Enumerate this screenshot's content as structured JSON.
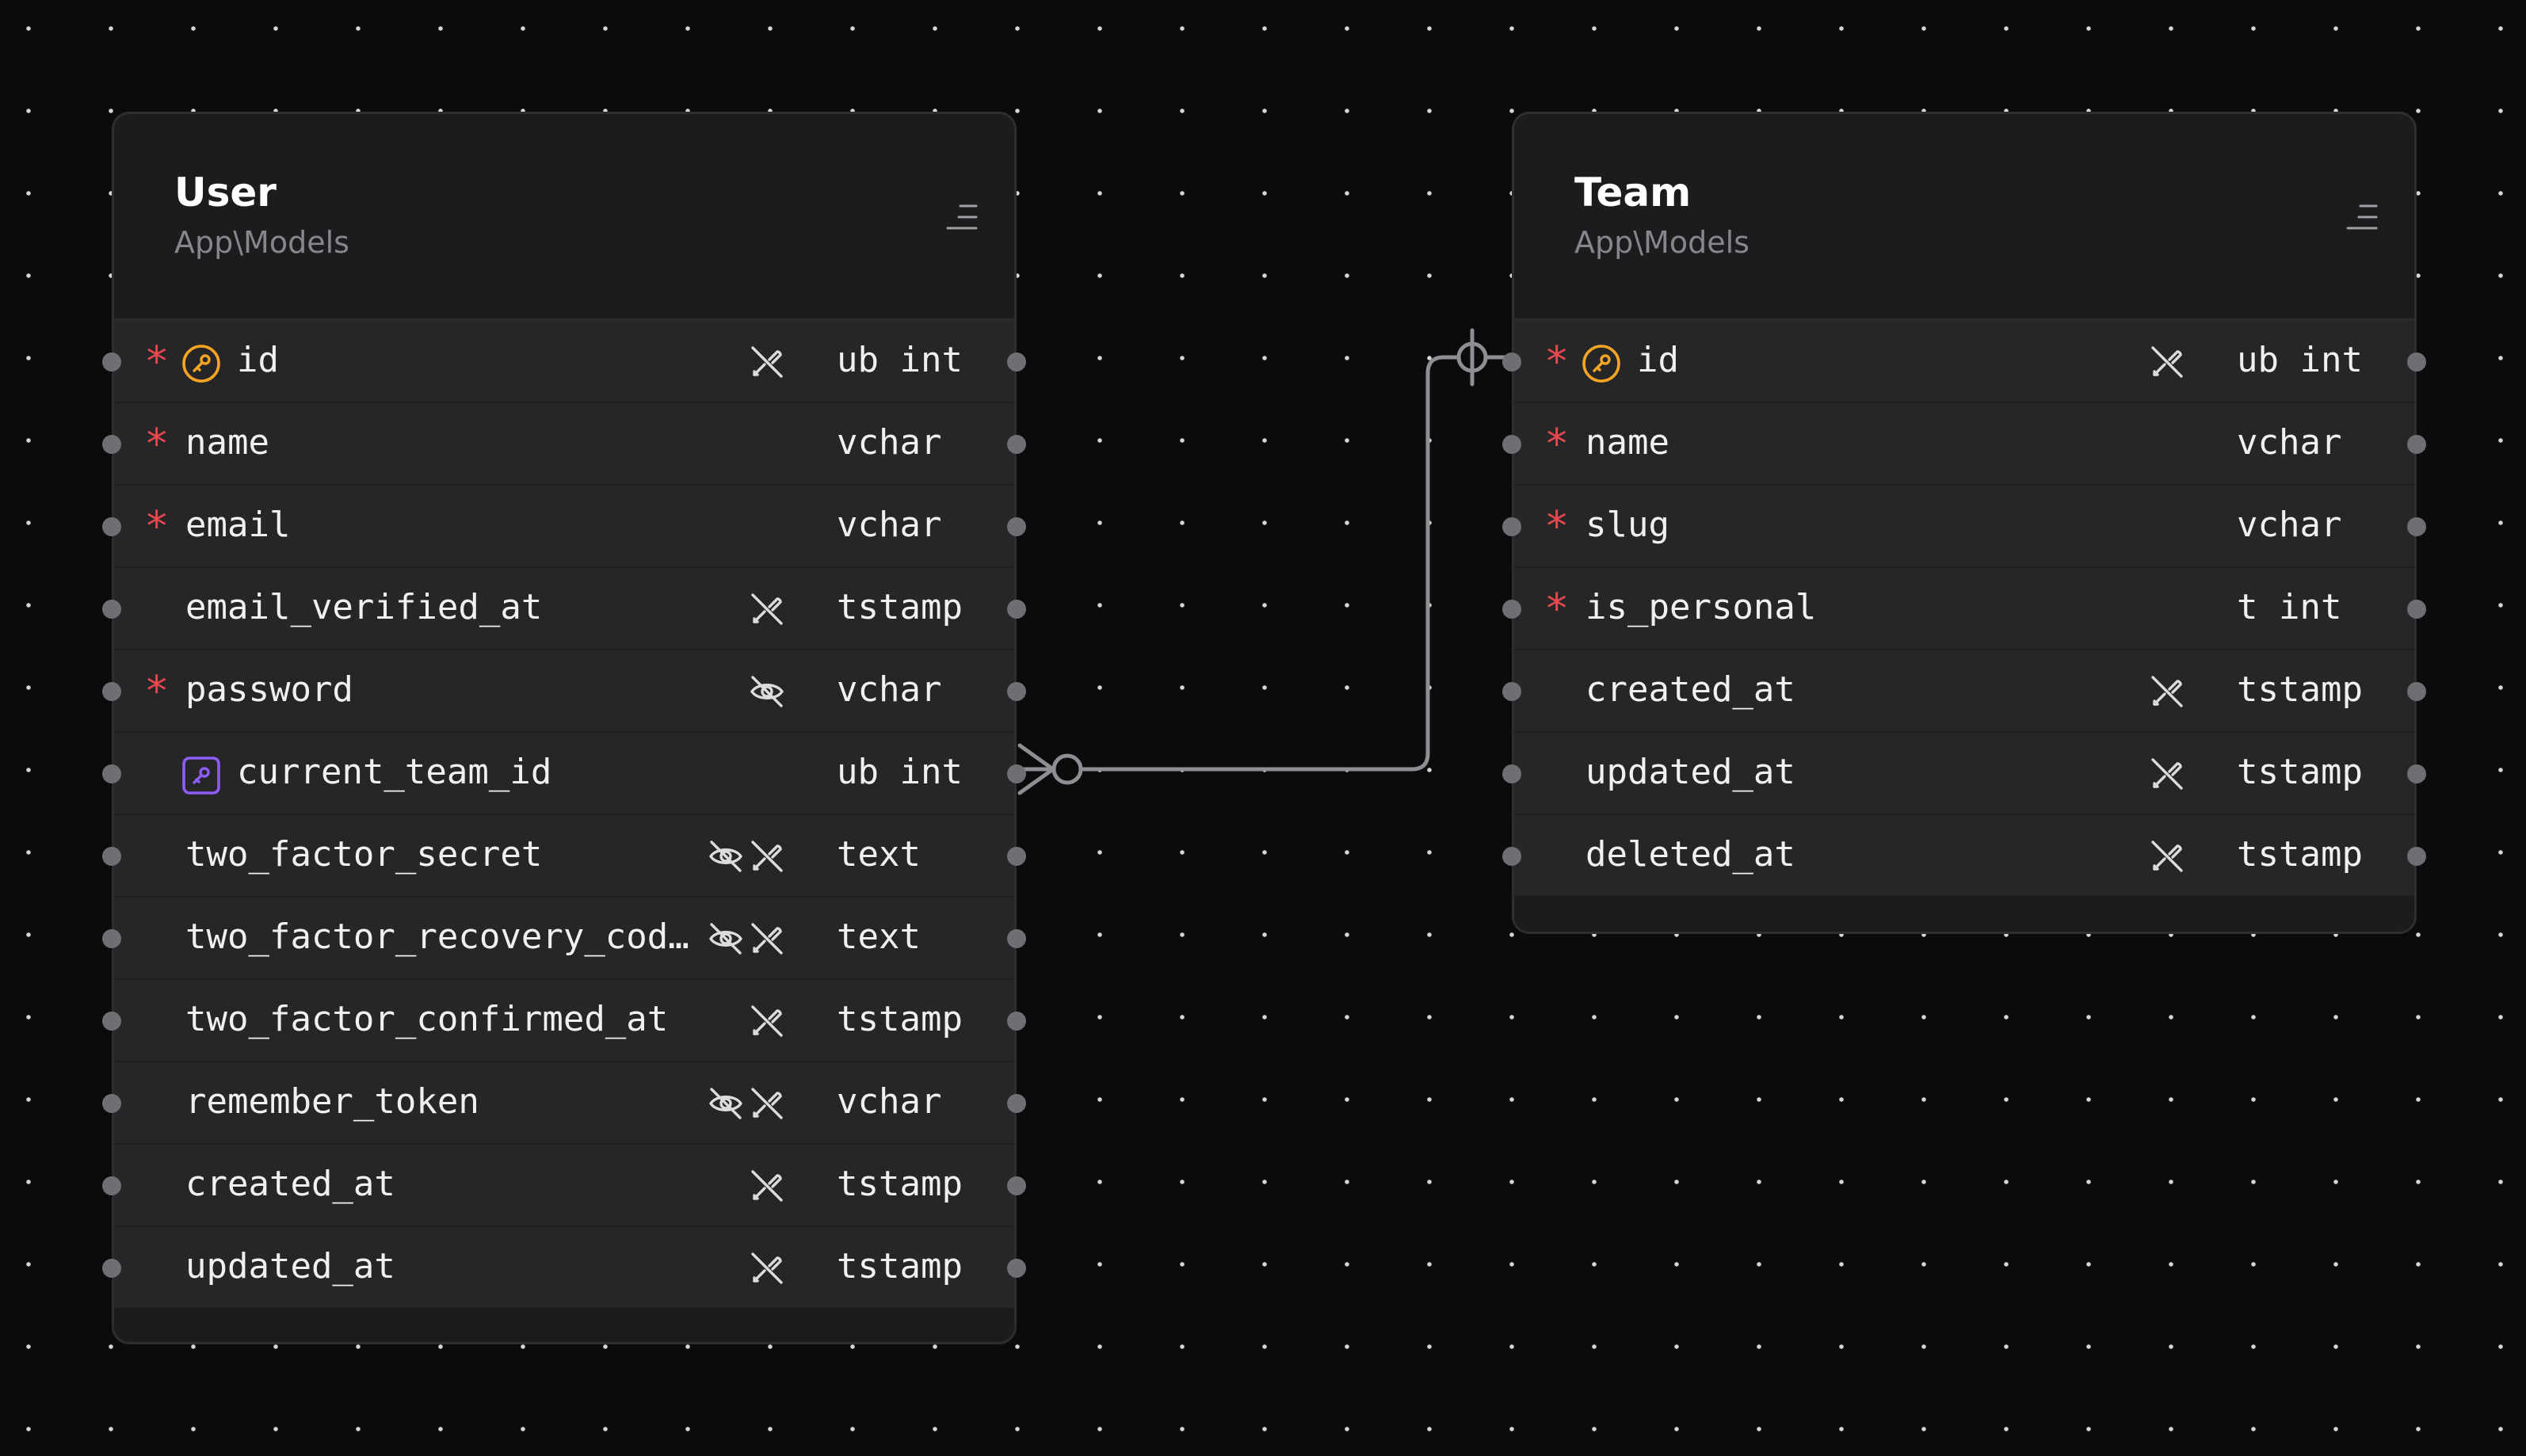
{
  "tables": [
    {
      "title": "User",
      "namespace": "App\\Models",
      "fields": [
        {
          "name": "id",
          "type": "ub int",
          "required": true,
          "key": "primary",
          "icons": [
            "nullable-off-icon"
          ]
        },
        {
          "name": "name",
          "type": "vchar",
          "required": true,
          "key": "",
          "icons": []
        },
        {
          "name": "email",
          "type": "vchar",
          "required": true,
          "key": "",
          "icons": []
        },
        {
          "name": "email_verified_at",
          "type": "tstamp",
          "required": false,
          "key": "",
          "icons": [
            "nullable-off-icon"
          ]
        },
        {
          "name": "password",
          "type": "vchar",
          "required": true,
          "key": "",
          "icons": [
            "hidden-icon"
          ]
        },
        {
          "name": "current_team_id",
          "type": "ub int",
          "required": false,
          "key": "foreign",
          "icons": []
        },
        {
          "name": "two_factor_secret",
          "type": "text",
          "required": false,
          "key": "",
          "icons": [
            "hidden-icon",
            "nullable-off-icon"
          ]
        },
        {
          "name": "two_factor_recovery_cod…",
          "type": "text",
          "required": false,
          "key": "",
          "icons": [
            "hidden-icon",
            "nullable-off-icon"
          ]
        },
        {
          "name": "two_factor_confirmed_at",
          "type": "tstamp",
          "required": false,
          "key": "",
          "icons": [
            "nullable-off-icon"
          ]
        },
        {
          "name": "remember_token",
          "type": "vchar",
          "required": false,
          "key": "",
          "icons": [
            "hidden-icon",
            "nullable-off-icon"
          ]
        },
        {
          "name": "created_at",
          "type": "tstamp",
          "required": false,
          "key": "",
          "icons": [
            "nullable-off-icon"
          ]
        },
        {
          "name": "updated_at",
          "type": "tstamp",
          "required": false,
          "key": "",
          "icons": [
            "nullable-off-icon"
          ]
        }
      ]
    },
    {
      "title": "Team",
      "namespace": "App\\Models",
      "fields": [
        {
          "name": "id",
          "type": "ub int",
          "required": true,
          "key": "primary",
          "icons": [
            "nullable-off-icon"
          ]
        },
        {
          "name": "name",
          "type": "vchar",
          "required": true,
          "key": "",
          "icons": []
        },
        {
          "name": "slug",
          "type": "vchar",
          "required": true,
          "key": "",
          "icons": []
        },
        {
          "name": "is_personal",
          "type": "t int",
          "required": true,
          "key": "",
          "icons": []
        },
        {
          "name": "created_at",
          "type": "tstamp",
          "required": false,
          "key": "",
          "icons": [
            "nullable-off-icon"
          ]
        },
        {
          "name": "updated_at",
          "type": "tstamp",
          "required": false,
          "key": "",
          "icons": [
            "nullable-off-icon"
          ]
        },
        {
          "name": "deleted_at",
          "type": "tstamp",
          "required": false,
          "key": "",
          "icons": [
            "nullable-off-icon"
          ]
        }
      ]
    }
  ],
  "relations": [
    {
      "from_table": "User",
      "from_field": "current_team_id",
      "from_cardinality": "many",
      "to_table": "Team",
      "to_field": "id",
      "to_cardinality": "zero-or-one"
    }
  ],
  "colors": {
    "background": "#0b0b0c",
    "node": "#1c1c1e",
    "row": "#262628",
    "required": "#e5484d",
    "primary_key": "#f5a524",
    "foreign_key": "#8e5cf7",
    "edge": "#8e8e93"
  }
}
